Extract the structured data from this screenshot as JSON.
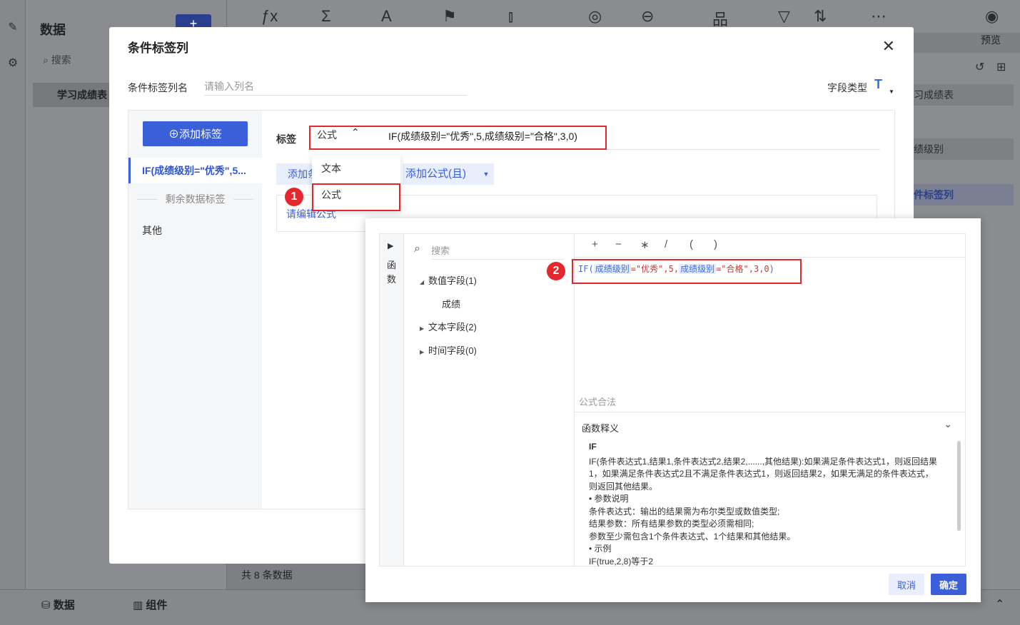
{
  "background": {
    "data_title": "数据",
    "search_placeholder": "搜索",
    "dataset_item": "学习成绩表",
    "preview_label": "预览",
    "total_label": "共 8 条数据",
    "bottom_tabs": [
      "数据",
      "组件"
    ],
    "right_items": [
      "习成绩表",
      "绩级别",
      "件标签列"
    ]
  },
  "modal": {
    "title": "条件标签列",
    "column_name_label": "条件标签列名",
    "column_name_placeholder": "请输入列名",
    "field_type_label": "字段类型",
    "field_type_icon": "text-type-icon",
    "add_tag_button": "⊕添加标签",
    "active_tag": "IF(成绩级别=\"优秀\",5...",
    "remaining_label": "剩余数据标签",
    "other_label": "其他",
    "tag_label": "标签",
    "tag_type_selected": "公式",
    "tag_formula": "IF(成绩级别=\"优秀\",5,成绩级别=\"合格\",3,0)",
    "add_button_partial": "添加条",
    "add_formula_button": "添加公式(且)",
    "edit_placeholder": "请编辑公式",
    "dropdown_options": [
      "文本",
      "公式"
    ]
  },
  "badges": [
    "1",
    "2"
  ],
  "formula_editor": {
    "side_label": "函数",
    "search_placeholder": "搜索",
    "tree": [
      {
        "label": "数值字段(1)",
        "expanded": true,
        "children": [
          "成绩"
        ]
      },
      {
        "label": "文本字段(2)",
        "expanded": false,
        "children": []
      },
      {
        "label": "时间字段(0)",
        "expanded": false,
        "children": []
      }
    ],
    "operators": [
      "+",
      "−",
      "∗",
      "/",
      "(",
      ")"
    ],
    "code": {
      "fn": "IF(",
      "field1": "成绩级别",
      "part1": "=\"优秀\",5,",
      "field2": "成绩级别",
      "part2": "=\"合格\",3,0",
      "close": ")"
    },
    "valid_label": "公式合法",
    "desc_title": "函数释义",
    "desc_fn": "IF",
    "desc_lines": [
      "IF(条件表达式1,结果1,条件表达式2,结果2,......,其他结果):如果满足条件表达式1，则返回结果1，如果满足条件表达式2且不满足条件表达式1，则返回结果2，如果无满足的条件表达式，则返回其他结果。",
      "• 参数说明",
      "条件表达式：输出的结果需为布尔类型或数值类型;",
      "结果参数：所有结果参数的类型必须需相同;",
      "参数至少需包含1个条件表达式、1个结果和其他结果。",
      "• 示例",
      "IF(true,2,8)等于2"
    ],
    "cancel_button": "取消",
    "ok_button": "确定"
  }
}
